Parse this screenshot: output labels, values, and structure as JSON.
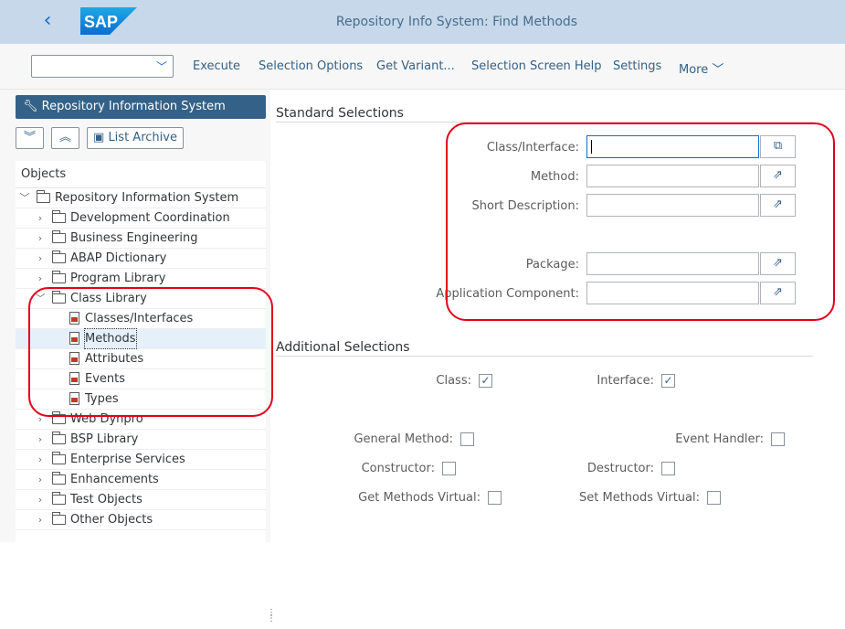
{
  "header": {
    "back_glyph": "‹",
    "logo_text": "SAP",
    "title": "Repository Info System: Find Methods"
  },
  "toolbar": {
    "dropdown_value": "",
    "buttons": [
      "Execute",
      "Selection Options",
      "Get Variant...",
      "Selection Screen Help",
      "Settings",
      "More"
    ]
  },
  "left_panel": {
    "ribbon_button": "Repository Information System",
    "list_archive": "List Archive",
    "objects_header": "Objects",
    "tree": [
      {
        "label": "Repository Information System",
        "level": 0,
        "expanded": true,
        "icon": "folder"
      },
      {
        "label": "Development Coordination",
        "level": 1,
        "expanded": false,
        "icon": "folder"
      },
      {
        "label": "Business Engineering",
        "level": 1,
        "expanded": false,
        "icon": "folder"
      },
      {
        "label": "ABAP Dictionary",
        "level": 1,
        "expanded": false,
        "icon": "folder"
      },
      {
        "label": "Program Library",
        "level": 1,
        "expanded": false,
        "icon": "folder"
      },
      {
        "label": "Class Library",
        "level": 1,
        "expanded": true,
        "icon": "folder"
      },
      {
        "label": "Classes/Interfaces",
        "level": 2,
        "icon": "doc"
      },
      {
        "label": "Methods",
        "level": 2,
        "icon": "doc",
        "selected": true
      },
      {
        "label": "Attributes",
        "level": 2,
        "icon": "doc"
      },
      {
        "label": "Events",
        "level": 2,
        "icon": "doc"
      },
      {
        "label": "Types",
        "level": 2,
        "icon": "doc"
      },
      {
        "label": "Web Dynpro",
        "level": 1,
        "expanded": false,
        "icon": "folder"
      },
      {
        "label": "BSP Library",
        "level": 1,
        "expanded": false,
        "icon": "folder"
      },
      {
        "label": "Enterprise Services",
        "level": 1,
        "expanded": false,
        "icon": "folder"
      },
      {
        "label": "Enhancements",
        "level": 1,
        "expanded": false,
        "icon": "folder"
      },
      {
        "label": "Test Objects",
        "level": 1,
        "expanded": false,
        "icon": "folder"
      },
      {
        "label": "Other Objects",
        "level": 1,
        "expanded": false,
        "icon": "folder"
      }
    ]
  },
  "standard_selections": {
    "title": "Standard Selections",
    "fields": [
      {
        "label": "Class/Interface:",
        "value": ""
      },
      {
        "label": "Method:",
        "value": ""
      },
      {
        "label": "Short Description:",
        "value": ""
      },
      {
        "label": "Package:",
        "value": ""
      },
      {
        "label": "Application Component:",
        "value": ""
      }
    ]
  },
  "additional_selections": {
    "title": "Additional Selections",
    "checkboxes": [
      {
        "label": "Class:",
        "checked": true
      },
      {
        "label": "Interface:",
        "checked": true
      },
      {
        "label": "General Method:",
        "checked": false
      },
      {
        "label": "Event Handler:",
        "checked": false
      },
      {
        "label": "Constructor:",
        "checked": false
      },
      {
        "label": "Destructor:",
        "checked": false
      },
      {
        "label": "Get Methods Virtual:",
        "checked": false
      },
      {
        "label": "Set Methods Virtual:",
        "checked": false
      }
    ]
  },
  "colors": {
    "accent": "#346187",
    "shell": "#c6d8ea",
    "highlight": "#e3001b"
  }
}
